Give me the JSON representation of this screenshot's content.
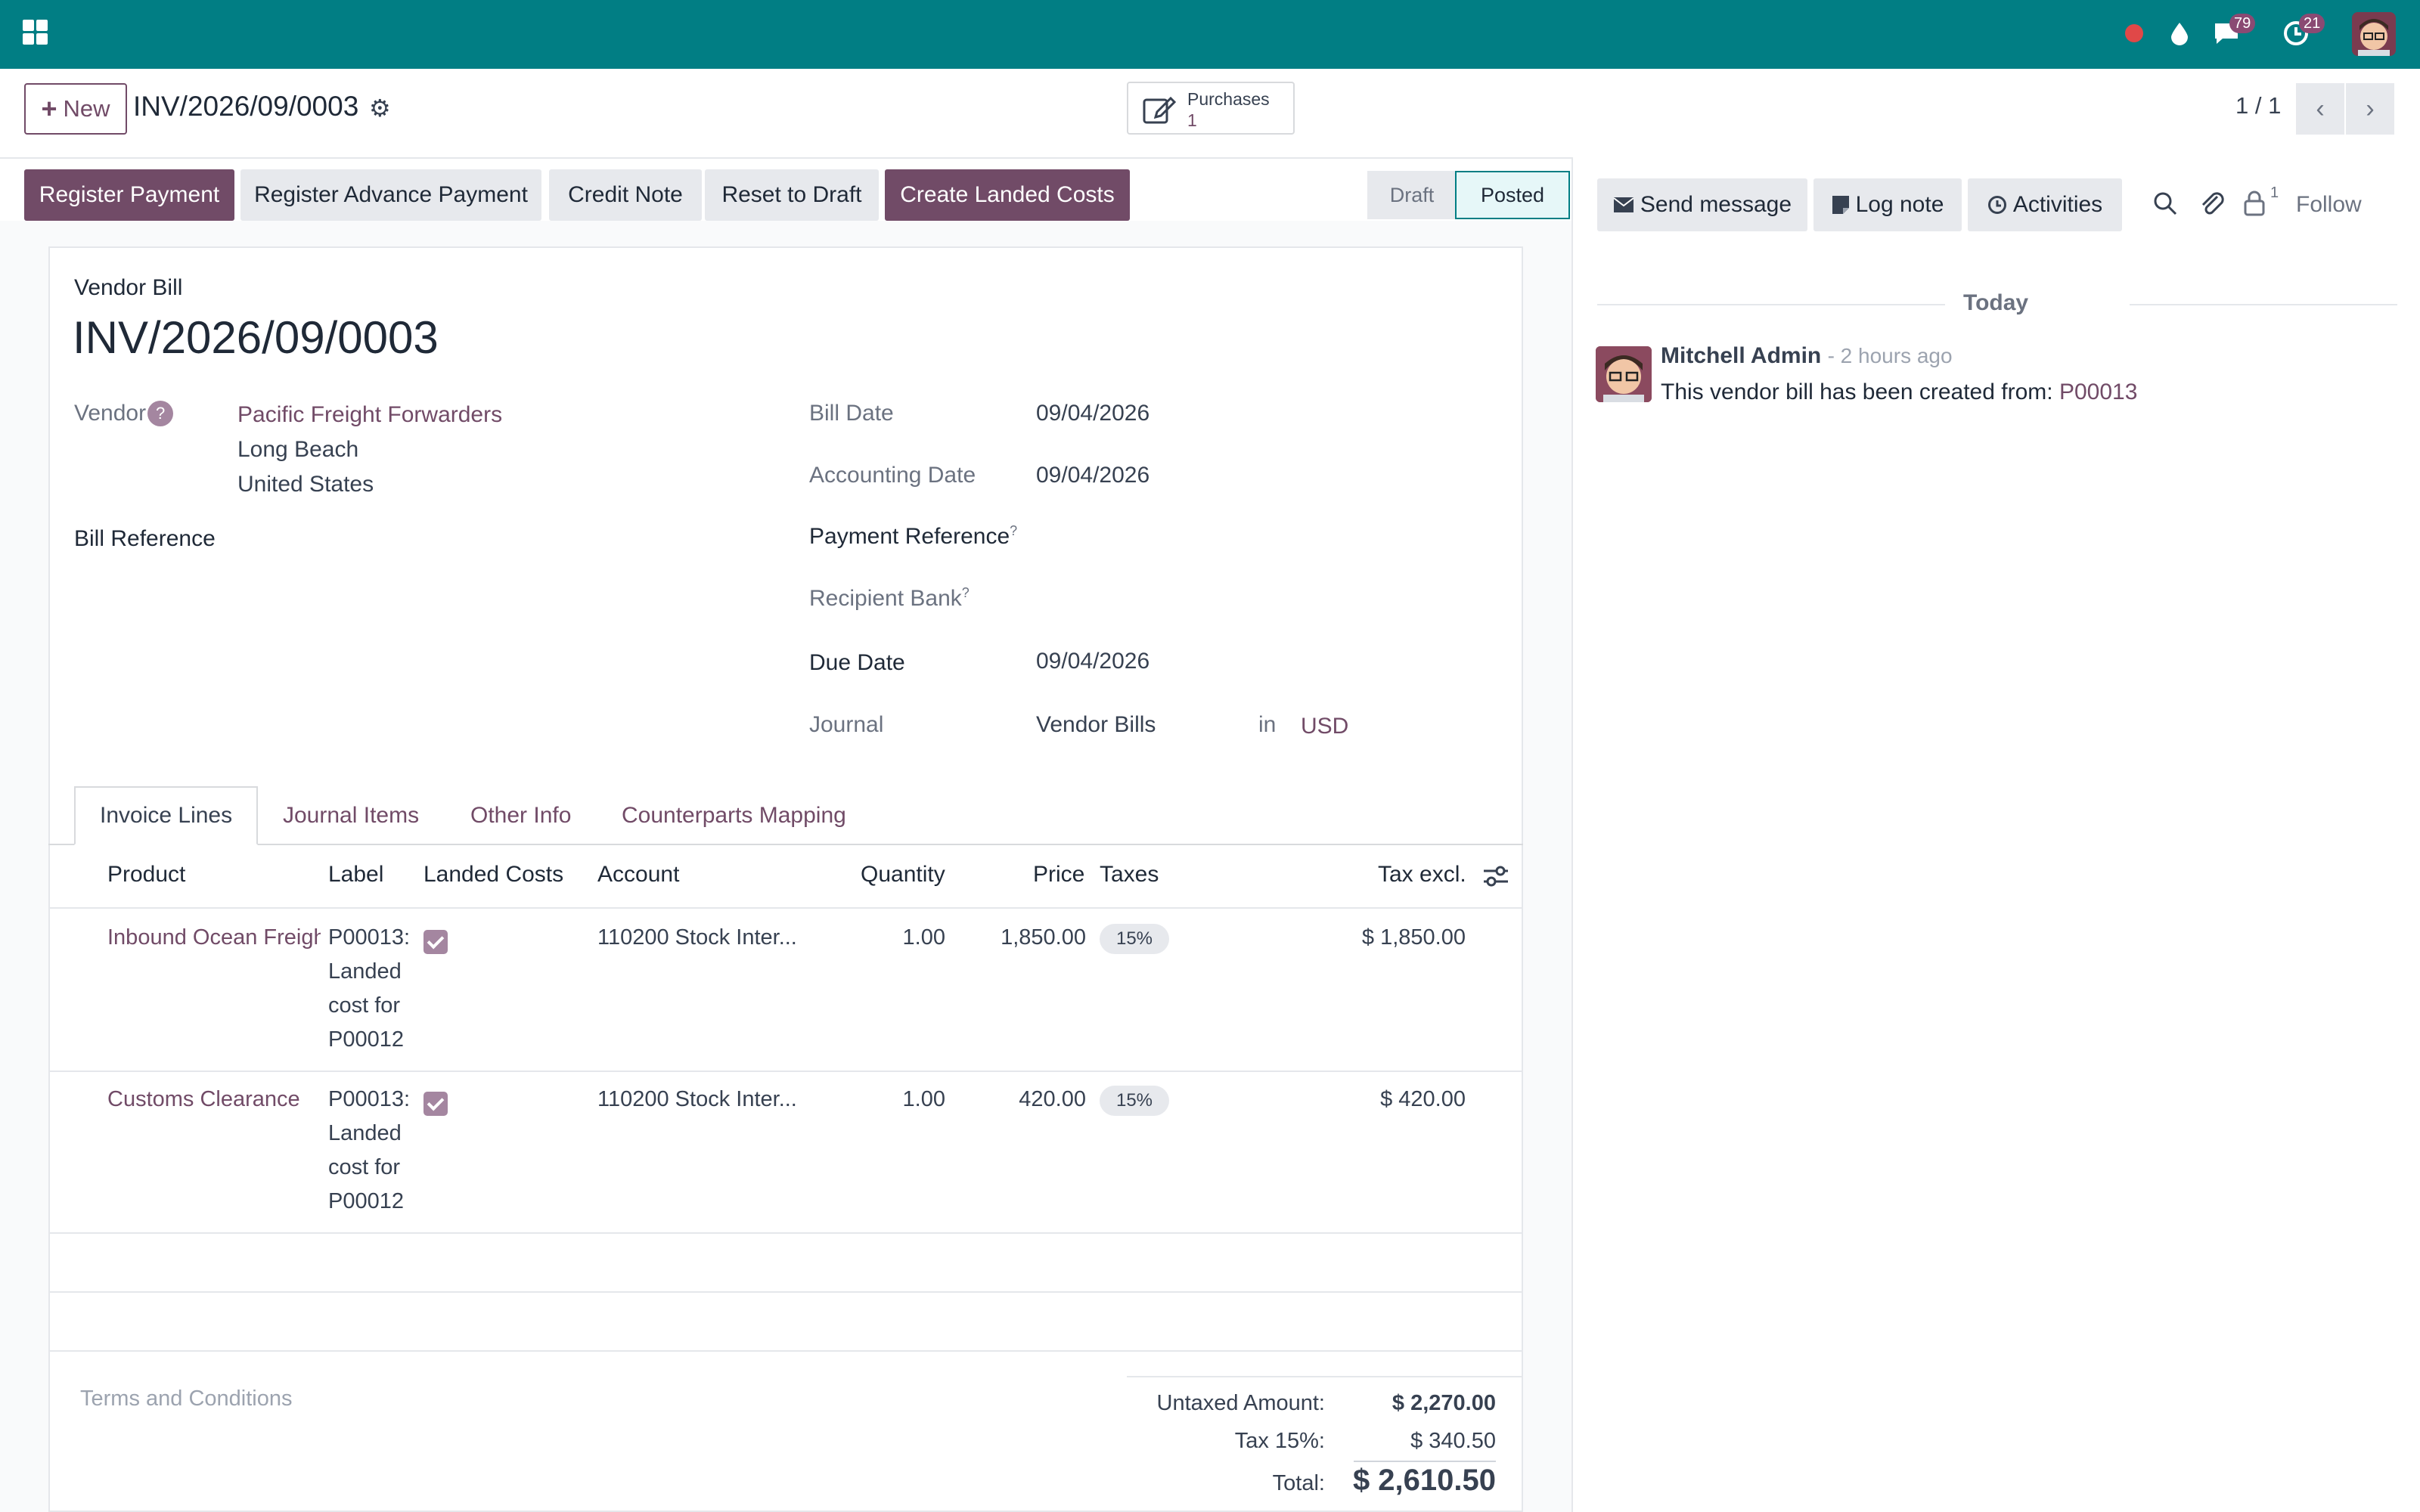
{
  "topbar": {
    "chat_count": "79",
    "activity_count": "21",
    "icons": [
      "apps-icon",
      "record-icon",
      "drop-icon",
      "chat-icon",
      "clock-icon",
      "user-avatar"
    ]
  },
  "control": {
    "new_label": "New",
    "record_title": "INV/2026/09/0003",
    "smart_button": {
      "label": "Purchases",
      "count": "1"
    },
    "pager": "1 / 1"
  },
  "statusbar": {
    "buttons": [
      "Register Payment",
      "Register Advance Payment",
      "Credit Note",
      "Reset to Draft",
      "Create Landed Costs"
    ],
    "stages": [
      "Draft",
      "Posted"
    ],
    "active_stage": "Posted"
  },
  "form": {
    "doc_type": "Vendor Bill",
    "title": "INV/2026/09/0003",
    "vendor_label": "Vendor",
    "vendor_help": "?",
    "vendor_name": "Pacific Freight Forwarders",
    "vendor_city": "Long Beach",
    "vendor_country": "United States",
    "bill_reference_label": "Bill Reference",
    "bill_date_label": "Bill Date",
    "bill_date": "09/04/2026",
    "accounting_date_label": "Accounting Date",
    "accounting_date": "09/04/2026",
    "payment_reference_label": "Payment Reference",
    "recipient_bank_label": "Recipient Bank",
    "help_mark": "?",
    "due_date_label": "Due Date",
    "due_date": "09/04/2026",
    "journal_label": "Journal",
    "journal": "Vendor Bills",
    "journal_in": "in",
    "currency": "USD"
  },
  "tabs": [
    "Invoice Lines",
    "Journal Items",
    "Other Info",
    "Counterparts Mapping"
  ],
  "table": {
    "columns": [
      "Product",
      "Label",
      "Landed Costs",
      "Account",
      "Quantity",
      "Price",
      "Taxes",
      "Tax excl."
    ],
    "rows": [
      {
        "product": "Inbound Ocean Freight",
        "label_lines": [
          "P00013:",
          "Landed",
          "cost for",
          "P00012"
        ],
        "landed_costs": true,
        "account": "110200 Stock Inter...",
        "quantity": "1.00",
        "price": "1,850.00",
        "tax": "15%",
        "subtotal": "$ 1,850.00"
      },
      {
        "product": "Customs Clearance",
        "label_lines": [
          "P00013:",
          "Landed",
          "cost for",
          "P00012"
        ],
        "landed_costs": true,
        "account": "110200 Stock Inter...",
        "quantity": "1.00",
        "price": "420.00",
        "tax": "15%",
        "subtotal": "$ 420.00"
      }
    ]
  },
  "footer": {
    "terms_placeholder": "Terms and Conditions",
    "untaxed_label": "Untaxed Amount:",
    "untaxed_value": "$ 2,270.00",
    "tax_label": "Tax 15%:",
    "tax_value": "$ 340.50",
    "total_label": "Total:",
    "total_value": "$ 2,610.50"
  },
  "chatter": {
    "send_message": "Send message",
    "log_note": "Log note",
    "activities": "Activities",
    "followers_count": "1",
    "follow": "Follow",
    "date_separator": "Today",
    "message": {
      "author": "Mitchell Admin",
      "time": "- 2 hours ago",
      "text": "This vendor bill has been created from:",
      "link": "P00013"
    }
  },
  "colors": {
    "topbar": "#017e84",
    "brand": "#714b67",
    "muted_bg": "#e7e9ed"
  }
}
